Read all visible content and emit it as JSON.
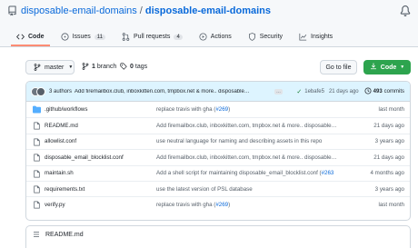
{
  "repo": {
    "owner": "disposable-email-domains",
    "name": "disposable-email-domains"
  },
  "tabs": [
    {
      "label": "Code",
      "icon": "code-icon",
      "selected": true
    },
    {
      "label": "Issues",
      "count": "11",
      "icon": "issue-icon"
    },
    {
      "label": "Pull requests",
      "count": "4",
      "icon": "pull-request-icon"
    },
    {
      "label": "Actions",
      "icon": "actions-icon"
    },
    {
      "label": "Security",
      "icon": "shield-icon"
    },
    {
      "label": "Insights",
      "icon": "graph-icon"
    }
  ],
  "toolbar": {
    "branch": "master",
    "branches_count": "1",
    "branches_label": "branch",
    "tags_count": "0",
    "tags_label": "tags",
    "go_to_file": "Go to file",
    "code_button": "Code"
  },
  "commit": {
    "authors": "3 authors",
    "message": "Add firemailbox.club, inboxkitten.com, tmpbox.net & more.. disposable…",
    "ellipsis": "…",
    "sha": "1ebafe5",
    "time": "21 days ago",
    "count": "493",
    "count_label": "commits"
  },
  "files": [
    {
      "name": ".github/workflows",
      "type": "folder",
      "commit": "replace travis with gha (",
      "pr": "#269",
      "commit_tail": ")",
      "age": "last month"
    },
    {
      "name": "README.md",
      "type": "file",
      "commit": "Add firemailbox.club, inboxkitten.com, tmpbox.net & more.. disposable…",
      "pr": "",
      "commit_tail": "",
      "age": "21 days ago"
    },
    {
      "name": "allowlist.conf",
      "type": "file",
      "commit": "use neutral language for naming and describing assets in this repo",
      "pr": "",
      "commit_tail": "",
      "age": "3 years ago"
    },
    {
      "name": "disposable_email_blocklist.conf",
      "type": "file",
      "commit": "Add firemailbox.club, inboxkitten.com, tmpbox.net & more.. disposable…",
      "pr": "",
      "commit_tail": "",
      "age": "21 days ago"
    },
    {
      "name": "maintain.sh",
      "type": "file",
      "commit": "Add a shell script for maintaining disposable_email_blocklist.conf (",
      "pr": "#263",
      "commit_tail": "",
      "age": "4 months ago"
    },
    {
      "name": "requirements.txt",
      "type": "file",
      "commit": "use the latest version of PSL database",
      "pr": "",
      "commit_tail": "",
      "age": "3 years ago"
    },
    {
      "name": "verify.py",
      "type": "file",
      "commit": "replace travis with gha (",
      "pr": "#269",
      "commit_tail": ")",
      "age": "last month"
    }
  ],
  "readme": {
    "title": "README.md"
  },
  "colors": {
    "accent_link": "#0969da",
    "code_button": "#2da44e",
    "selected_tab_underline": "#fd8c73",
    "commit_bar": "#ddf4ff",
    "folder_icon": "#54aeff"
  }
}
